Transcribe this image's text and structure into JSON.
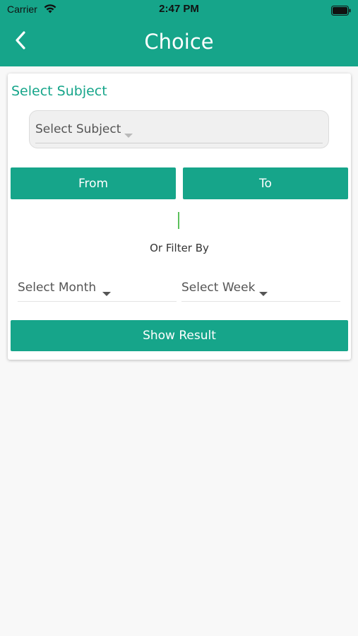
{
  "status_bar": {
    "carrier": "Carrier",
    "time": "2:47 PM"
  },
  "nav": {
    "title": "Choice",
    "back_icon": "chevron-left-icon"
  },
  "form": {
    "section_title": "Select Subject",
    "subject_select": {
      "placeholder": "Select Subject"
    },
    "from_label": "From",
    "to_label": "To",
    "filter_label": "Or Filter By",
    "month_select": {
      "placeholder": "Select Month"
    },
    "week_select": {
      "placeholder": "Select Week"
    },
    "show_result_label": "Show Result"
  },
  "colors": {
    "accent": "#16a58a",
    "background": "#f8f8f8",
    "card": "#ffffff"
  }
}
